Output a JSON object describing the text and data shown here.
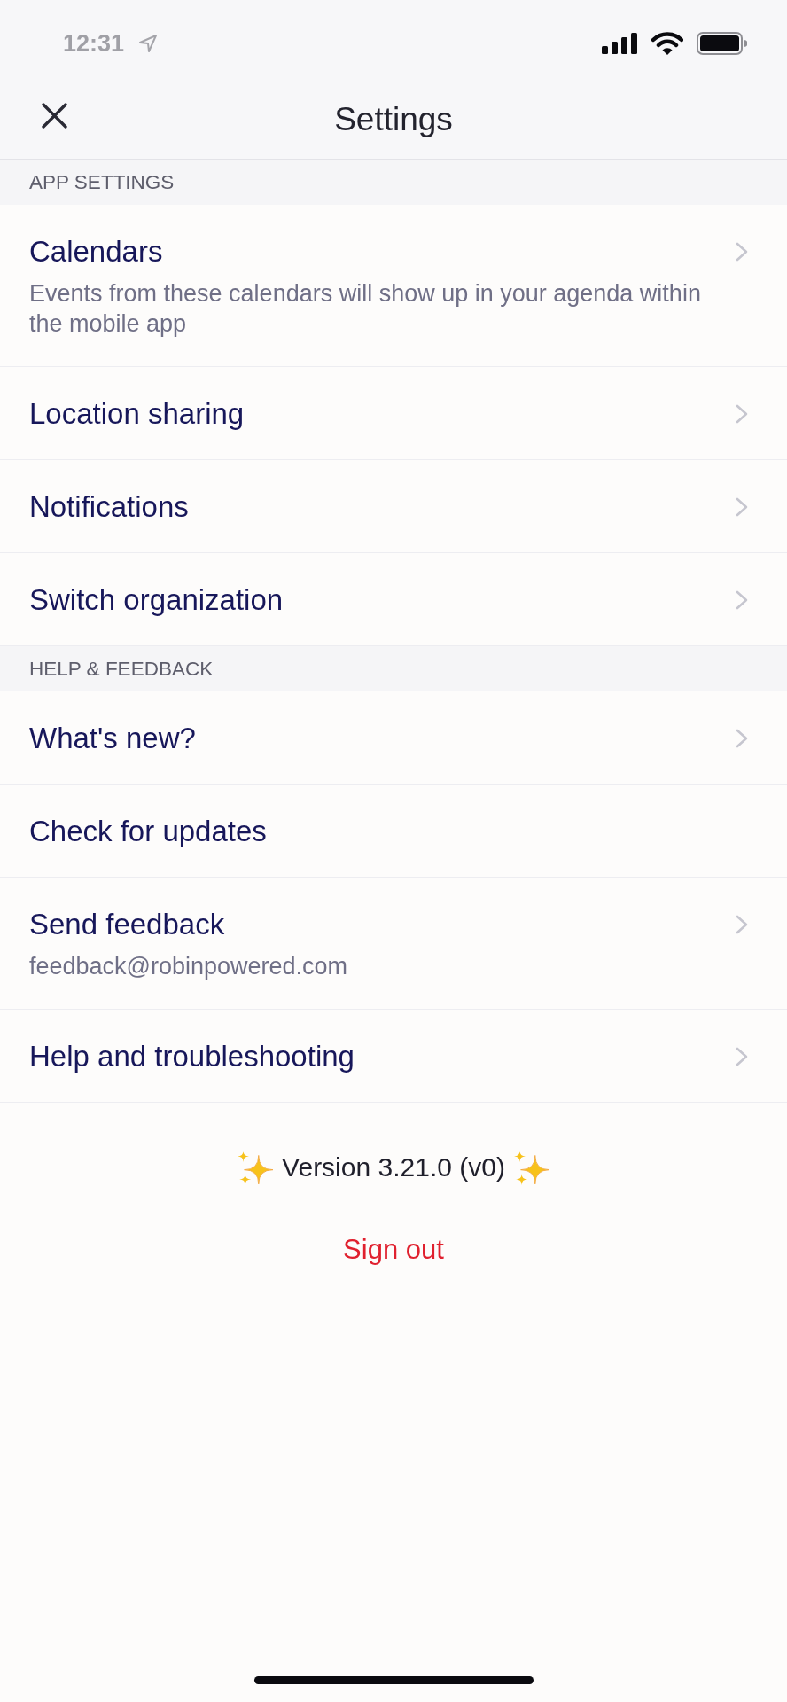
{
  "status_bar": {
    "time": "12:31"
  },
  "header": {
    "title": "Settings"
  },
  "sections": [
    {
      "title": "APP SETTINGS",
      "items": [
        {
          "label": "Calendars",
          "subtitle": "Events from these calendars will show up in your agenda within the mobile app",
          "chevron": true
        },
        {
          "label": "Location sharing",
          "chevron": true
        },
        {
          "label": "Notifications",
          "chevron": true
        },
        {
          "label": "Switch organization",
          "chevron": true
        }
      ]
    },
    {
      "title": "HELP & FEEDBACK",
      "items": [
        {
          "label": "What's new?",
          "chevron": true
        },
        {
          "label": "Check for updates",
          "chevron": false
        },
        {
          "label": "Send feedback",
          "subtitle": "feedback@robinpowered.com",
          "chevron": true
        },
        {
          "label": "Help and troubleshooting",
          "chevron": true
        }
      ]
    }
  ],
  "footer": {
    "version": "Version 3.21.0 (v0)",
    "sign_out": "Sign out"
  }
}
